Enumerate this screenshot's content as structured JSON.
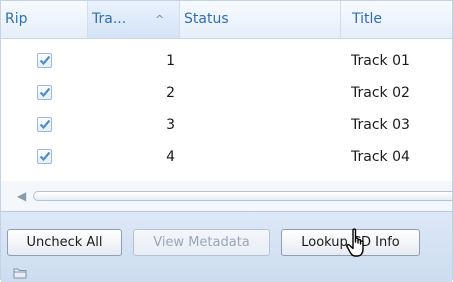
{
  "columns": {
    "rip": "Rip",
    "track": "Tra...",
    "track_sort_indicator": "^",
    "status": "Status",
    "title": "Title"
  },
  "tracks": [
    {
      "checked": true,
      "number": "1",
      "status": "",
      "title": "Track 01"
    },
    {
      "checked": true,
      "number": "2",
      "status": "",
      "title": "Track 02"
    },
    {
      "checked": true,
      "number": "3",
      "status": "",
      "title": "Track 03"
    },
    {
      "checked": true,
      "number": "4",
      "status": "",
      "title": "Track 04"
    }
  ],
  "buttons": {
    "uncheck_all": "Uncheck All",
    "view_metadata": "View Metadata",
    "lookup_cd_info": "Lookup CD Info"
  },
  "colors": {
    "header_text": "#2f6fb7",
    "checkmark": "#4a8fd6",
    "toolbar_bg": "#cddcf0"
  },
  "icons": {
    "scroll_left": "triangle-left",
    "checkmark": "check",
    "folder": "folder",
    "cursor": "hand-pointer"
  }
}
